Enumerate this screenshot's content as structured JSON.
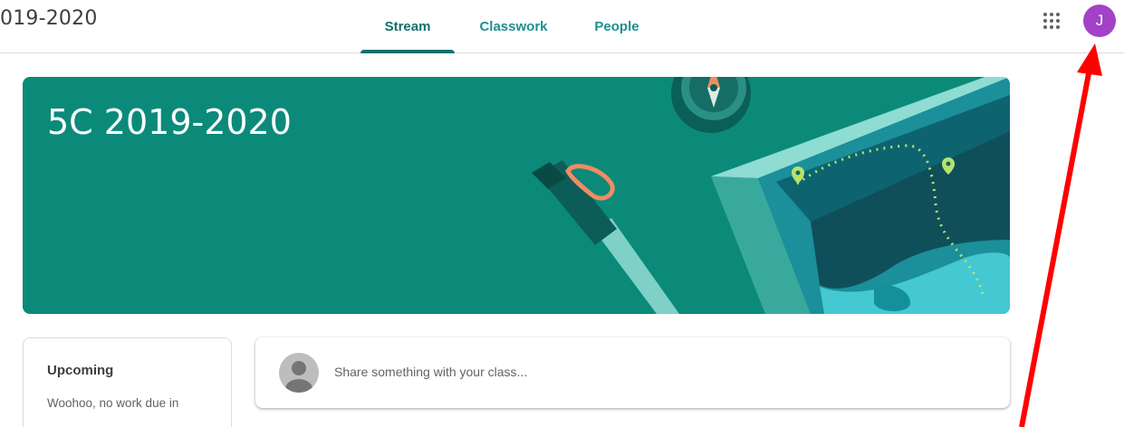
{
  "header": {
    "class_name": "019-2020",
    "tabs": [
      {
        "label": "Stream",
        "active": true
      },
      {
        "label": "Classwork",
        "active": false
      },
      {
        "label": "People",
        "active": false
      }
    ],
    "apps_icon": "google-apps-grid-icon",
    "avatar_letter": "J",
    "avatar_color": "#a142c7"
  },
  "banner": {
    "title": "5C 2019-2020",
    "background_color": "#0b8a7a"
  },
  "upcoming": {
    "title": "Upcoming",
    "text": "Woohoo, no work due in"
  },
  "share": {
    "placeholder": "Share something with your class..."
  },
  "colors": {
    "accent": "#137070",
    "annotation_arrow": "#ff0000"
  }
}
